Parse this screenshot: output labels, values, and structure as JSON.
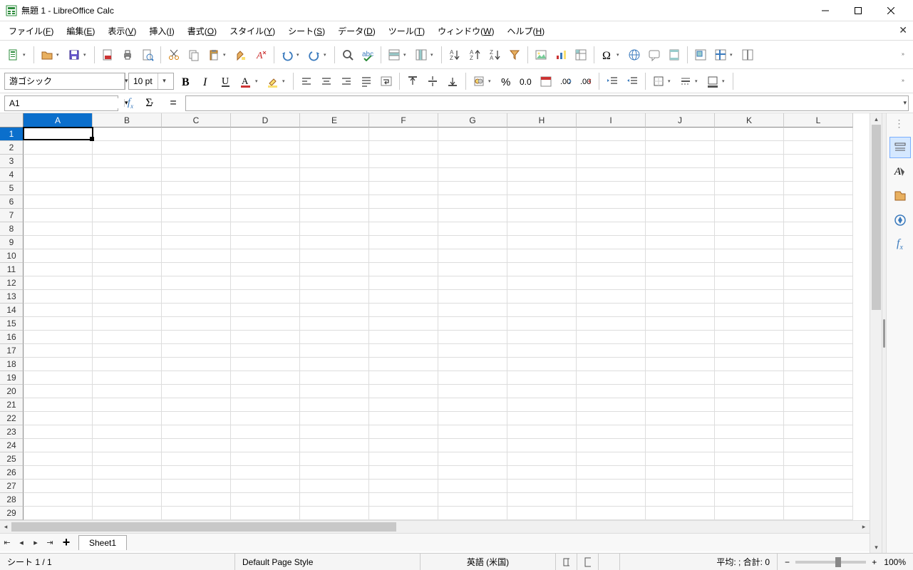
{
  "title": "無題 1 - LibreOffice Calc",
  "menu": [
    "ファイル(F)",
    "編集(E)",
    "表示(V)",
    "挿入(I)",
    "書式(O)",
    "スタイル(Y)",
    "シート(S)",
    "データ(D)",
    "ツール(T)",
    "ウィンドウ(W)",
    "ヘルプ(H)"
  ],
  "font_name": "游ゴシック",
  "font_size": "10 pt",
  "cell_ref": "A1",
  "formula": "",
  "columns": [
    "A",
    "B",
    "C",
    "D",
    "E",
    "F",
    "G",
    "H",
    "I",
    "J",
    "K",
    "L"
  ],
  "rows": [
    1,
    2,
    3,
    4,
    5,
    6,
    7,
    8,
    9,
    10,
    11,
    12,
    13,
    14,
    15,
    16,
    17,
    18,
    19,
    20,
    21,
    22,
    23,
    24,
    25,
    26,
    27,
    28,
    29
  ],
  "active_col": 0,
  "active_row": 0,
  "sheet_tab": "Sheet1",
  "status": {
    "sheet": "シート 1 / 1",
    "style": "Default Page Style",
    "lang": "英語 (米国)",
    "summary": "平均: ; 合計: 0",
    "zoom": "100%"
  },
  "side_icons": [
    "properties",
    "styles",
    "gallery",
    "navigator",
    "functions"
  ],
  "toolbar1": [
    {
      "n": "new",
      "ico": "doc-new",
      "dd": 1
    },
    {
      "sep": 1
    },
    {
      "n": "open",
      "ico": "open",
      "dd": 1
    },
    {
      "n": "save",
      "ico": "save",
      "dd": 1
    },
    {
      "sep": 1
    },
    {
      "n": "export-pdf",
      "ico": "pdf"
    },
    {
      "n": "print",
      "ico": "print"
    },
    {
      "n": "print-preview",
      "ico": "preview"
    },
    {
      "sep": 1
    },
    {
      "n": "cut",
      "ico": "cut"
    },
    {
      "n": "copy",
      "ico": "copy"
    },
    {
      "n": "paste",
      "ico": "paste",
      "dd": 1
    },
    {
      "n": "clone-formatting",
      "ico": "clone"
    },
    {
      "n": "clear",
      "ico": "clear"
    },
    {
      "sep": 1
    },
    {
      "n": "undo",
      "ico": "undo",
      "dd": 1
    },
    {
      "n": "redo",
      "ico": "redo",
      "dd": 1
    },
    {
      "sep": 1
    },
    {
      "n": "find",
      "ico": "find"
    },
    {
      "n": "spellcheck",
      "ico": "spell"
    },
    {
      "sep": 1
    },
    {
      "n": "row",
      "ico": "row",
      "dd": 1
    },
    {
      "n": "column",
      "ico": "col",
      "dd": 1
    },
    {
      "sep": 1
    },
    {
      "n": "sort",
      "ico": "sort"
    },
    {
      "n": "sort-asc",
      "ico": "asc"
    },
    {
      "n": "sort-desc",
      "ico": "desc"
    },
    {
      "n": "autofilter",
      "ico": "filter"
    },
    {
      "sep": 1
    },
    {
      "n": "image",
      "ico": "img"
    },
    {
      "n": "chart",
      "ico": "chart"
    },
    {
      "n": "pivot",
      "ico": "pivot"
    },
    {
      "sep": 1
    },
    {
      "n": "special-char",
      "ico": "omega",
      "dd": 1
    },
    {
      "n": "hyperlink",
      "ico": "link"
    },
    {
      "n": "comment",
      "ico": "comment"
    },
    {
      "n": "header-footer",
      "ico": "hf"
    },
    {
      "sep": 1
    },
    {
      "n": "define-print",
      "ico": "printrange"
    },
    {
      "n": "freeze",
      "ico": "freeze",
      "dd": 1
    },
    {
      "n": "split",
      "ico": "split"
    }
  ],
  "toolbar2": [
    {
      "n": "bold",
      "ico": "bold"
    },
    {
      "n": "italic",
      "ico": "italic"
    },
    {
      "n": "underline",
      "ico": "underline"
    },
    {
      "n": "font-color",
      "ico": "fontcolor",
      "dd": 1
    },
    {
      "n": "highlight",
      "ico": "highlight",
      "dd": 1
    },
    {
      "sep": 1
    },
    {
      "n": "align-left",
      "ico": "al"
    },
    {
      "n": "align-center",
      "ico": "ac"
    },
    {
      "n": "align-right",
      "ico": "ar"
    },
    {
      "n": "justify",
      "ico": "aj"
    },
    {
      "n": "wrap",
      "ico": "wrap"
    },
    {
      "sep": 1
    },
    {
      "n": "valign-top",
      "ico": "vt"
    },
    {
      "n": "valign-middle",
      "ico": "vm"
    },
    {
      "n": "valign-bottom",
      "ico": "vb"
    },
    {
      "sep": 1
    },
    {
      "n": "currency",
      "ico": "cur",
      "dd": 1
    },
    {
      "n": "percent",
      "ico": "pct"
    },
    {
      "n": "number",
      "ico": "num"
    },
    {
      "n": "date",
      "ico": "date"
    },
    {
      "n": "add-decimal",
      "ico": "decadd"
    },
    {
      "n": "del-decimal",
      "ico": "decdel"
    },
    {
      "sep": 1
    },
    {
      "n": "indent-inc",
      "ico": "indinc"
    },
    {
      "n": "indent-dec",
      "ico": "inddec"
    },
    {
      "sep": 1
    },
    {
      "n": "borders",
      "ico": "borders",
      "dd": 1
    },
    {
      "n": "border-style",
      "ico": "bstyle",
      "dd": 1
    },
    {
      "n": "border-color",
      "ico": "bcolor",
      "dd": 1
    },
    {
      "sep": 1
    }
  ]
}
